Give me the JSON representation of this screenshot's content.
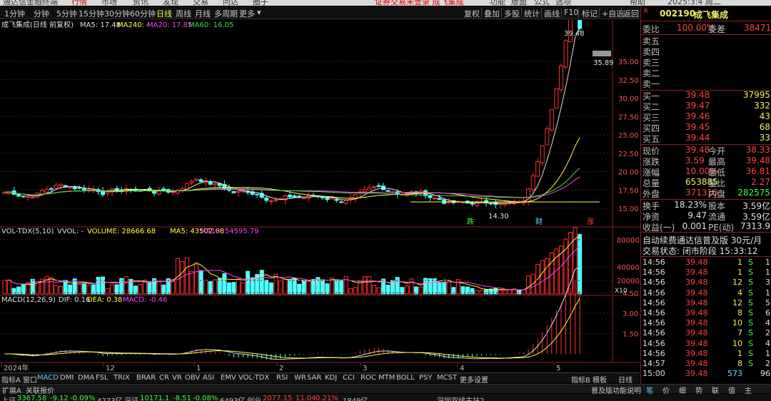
{
  "top_menu": {
    "items": [
      "通达信金融终端",
      "行情",
      "市场",
      "资讯",
      "发现",
      "交易",
      "问达",
      "圈子"
    ],
    "notice": "证券交易未登录  成飞集成",
    "right_items": [
      "功能",
      "版面",
      "公式",
      "选项",
      "帮助"
    ],
    "clock": "2025:3:4 周二"
  },
  "toolbar": {
    "periods": [
      "1分钟",
      "分钟",
      "5分钟",
      "15分钟",
      "30分钟",
      "60分钟",
      "日线",
      "周线",
      "月线",
      "多周期",
      "更多"
    ],
    "active_period": "日线",
    "tools": [
      "复权",
      "叠加",
      "多股",
      "统计",
      "画线",
      "F10",
      "标记",
      "+自选",
      "返回"
    ]
  },
  "chart_header": {
    "name": "成飞集成(日线 前复权)",
    "ma5": "MA5: 17.48",
    "ma240": "MA240: -",
    "ma20": "MA20: 17.85",
    "ma60": "MA60: 16.05"
  },
  "price_axis": [
    "35.00",
    "32.50",
    "30.00",
    "27.50",
    "25.00",
    "22.50",
    "20.00",
    "17.50",
    "15.00"
  ],
  "price_labels": {
    "high": "39.48",
    "low_mark": "35.89",
    "min": "14.30"
  },
  "markers": {
    "die": "跌",
    "cai": "财",
    "zhang": "涨"
  },
  "vol_header": {
    "name": "VOL-TDX(5,10)",
    "vvol": "VVOL: -",
    "volume": "VOLUME: 28666.68",
    "ma5": "MA5: 43502.68",
    "ma10": "MA10: 54595.79"
  },
  "vol_axis": [
    "80000",
    "40000",
    "20000"
  ],
  "vol_unit": "X10",
  "macd_header": {
    "name": "MACD(12,26,9)",
    "dif": "DIF: 0.16",
    "dea": "DEA: 0.38",
    "macd": "MACD: -0.46"
  },
  "macd_axis": [
    "4.50",
    "3.00",
    "1.50"
  ],
  "date_axis": [
    "2024年",
    "12",
    "1",
    "2",
    "3",
    "4",
    "5"
  ],
  "stock": {
    "code": "002190",
    "name": "成飞集成"
  },
  "quote": {
    "weibi_label": "委比",
    "weibi": "100.00%",
    "weicha_label": "委差",
    "weicha": "38471",
    "asks": [
      {
        "label": "卖五"
      },
      {
        "label": "卖四"
      },
      {
        "label": "卖三"
      },
      {
        "label": "卖二"
      },
      {
        "label": "卖一"
      }
    ],
    "bids": [
      {
        "label": "买一",
        "price": "39.48",
        "vol": "37995"
      },
      {
        "label": "买二",
        "price": "39.47",
        "vol": "332"
      },
      {
        "label": "买三",
        "price": "39.46",
        "vol": "43"
      },
      {
        "label": "买四",
        "price": "39.45",
        "vol": "68"
      },
      {
        "label": "买五",
        "price": "39.44",
        "vol": "33"
      }
    ],
    "stats": [
      {
        "l1": "现价",
        "v1": "39.48",
        "l2": "今开",
        "v2": "38.33"
      },
      {
        "l1": "涨跌",
        "v1": "3.59",
        "l2": "最高",
        "v2": "39.48"
      },
      {
        "l1": "涨幅",
        "v1": "10.00%",
        "l2": "最低",
        "v2": "36.81"
      },
      {
        "l1": "总量",
        "v1": "653885",
        "l2": "量比",
        "v2": "2.27"
      },
      {
        "l1": "外盘",
        "v1": "371310",
        "l2": "内盘",
        "v2": "282575"
      }
    ],
    "fund": [
      {
        "l1": "换手",
        "v1": "18.23%",
        "l2": "股本",
        "v2": "3.59亿"
      },
      {
        "l1": "净资",
        "v1": "9.47",
        "l2": "流通",
        "v2": "3.59亿"
      },
      {
        "l1": "收益(一)",
        "v1": "0.001",
        "l2": "PE(动)",
        "v2": "7313.9"
      }
    ],
    "promo": "自动续费通达信普及版  30元/月",
    "trade_state": "交易状态: 闭市阶段 15:33:12"
  },
  "ticks": [
    {
      "t": "14:56",
      "p": "39.48",
      "v": "1",
      "s": "S",
      "n": "1"
    },
    {
      "t": "14:56",
      "p": "39.48",
      "v": "1",
      "s": "S",
      "n": "1"
    },
    {
      "t": "14:56",
      "p": "39.48",
      "v": "12",
      "s": "S",
      "n": "3"
    },
    {
      "t": "14:56",
      "p": "39.48",
      "v": "4",
      "s": "S",
      "n": "1"
    },
    {
      "t": "14:56",
      "p": "39.48",
      "v": "12",
      "s": "S",
      "n": "5"
    },
    {
      "t": "14:56",
      "p": "39.48",
      "v": "8",
      "s": "S",
      "n": "6"
    },
    {
      "t": "14:56",
      "p": "39.48",
      "v": "10",
      "s": "S",
      "n": "4"
    },
    {
      "t": "14:56",
      "p": "39.48",
      "v": "7",
      "s": "S",
      "n": "2"
    },
    {
      "t": "14:56",
      "p": "39.48",
      "v": "10",
      "s": "S",
      "n": "4"
    },
    {
      "t": "14:56",
      "p": "39.48",
      "v": "1",
      "s": "S",
      "n": "1"
    },
    {
      "t": "14:57",
      "p": "39.48",
      "v": "8",
      "s": "S",
      "n": "2"
    },
    {
      "t": "15:00",
      "p": "39.48",
      "v": "573",
      "s": "",
      "n": "96"
    }
  ],
  "indicator_tabs": [
    "指标A",
    "窗口",
    "MACD",
    "DMI",
    "DMA",
    "FSL",
    "TRIX",
    "BRAR",
    "CR",
    "VR",
    "OBV",
    "ASI",
    "EMV",
    "VOL-TDX",
    "RSI",
    "WR",
    "SAR",
    "KDJ",
    "CCI",
    "ROC",
    "MTM",
    "BOLL",
    "PSY",
    "MCST",
    "更多",
    "设置"
  ],
  "indicator_tab_right": [
    "指标B",
    "模板",
    "日线"
  ],
  "bottom_bar": {
    "left": [
      "扩展A",
      "关联报价"
    ],
    "right": "普及版功能说明"
  },
  "right_tabs": [
    "笔",
    "价",
    "细",
    "势",
    "联",
    "值",
    "主"
  ],
  "status": [
    {
      "label": "上证",
      "val": "3367.58",
      "chg": "-9.12",
      "pct": "-0.09%",
      "amt": "4273亿"
    },
    {
      "label": "深证",
      "val": "10171.1",
      "chg": "-8.51",
      "pct": "-0.08%",
      "amt": "6493亿"
    },
    {
      "label": "创业",
      "val": "2077.15",
      "chg": "11.04",
      "pct": "0.21%",
      "amt": "1849亿"
    }
  ],
  "status_right": "深圳双线主站2",
  "colors": {
    "up": "#ff3030",
    "down": "#50ffff",
    "ma5": "#e0e0e0",
    "ma20": "#ffff40",
    "ma60": "#ff40ff",
    "ma_green": "#40e040"
  }
}
